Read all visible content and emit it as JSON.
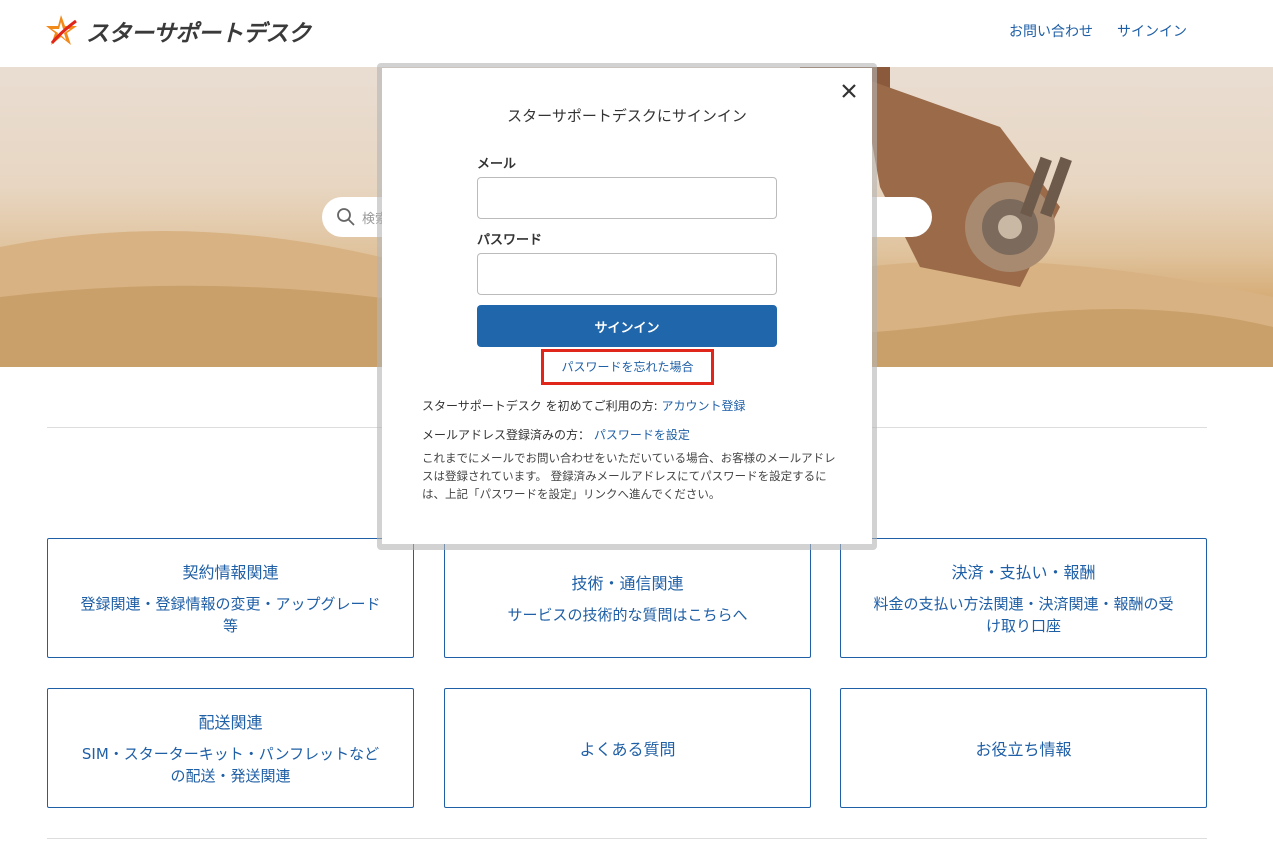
{
  "header": {
    "brand": "スターサポートデスク",
    "nav": {
      "contact": "お問い合わせ",
      "signin": "サインイン"
    }
  },
  "hero": {
    "search_placeholder": "検索"
  },
  "categories": [
    {
      "title": "契約情報関連",
      "desc": "登録関連・登録情報の変更・アップグレード等"
    },
    {
      "title": "技術・通信関連",
      "desc": "サービスの技術的な質問はこちらへ"
    },
    {
      "title": "決済・支払い・報酬",
      "desc": "料金の支払い方法関連・決済関連・報酬の受け取り口座"
    },
    {
      "title": "配送関連",
      "desc": "SIM・スターターキット・パンフレットなどの配送・発送関連"
    },
    {
      "title": "よくある質問",
      "desc": ""
    },
    {
      "title": "お役立ち情報",
      "desc": ""
    }
  ],
  "modal": {
    "title": "スターサポートデスクにサインイン",
    "email_label": "メール",
    "email_value": "",
    "password_label": "パスワード",
    "password_value": "",
    "signin_button": "サインイン",
    "forgot_link": "パスワードを忘れた場合",
    "first_time_text": "スターサポートデスク を初めてご利用の方: ",
    "register_link": "アカウント登録",
    "registered_text": "メールアドレス登録済みの方： ",
    "set_password_link": "パスワードを設定",
    "note": "これまでにメールでお問い合わせをいただいている場合、お客様のメールアドレスは登録されています。 登録済みメールアドレスにてパスワードを設定するには、上記「パスワードを設定」リンクへ進んでください。"
  },
  "colors": {
    "link": "#1f5fa6",
    "button": "#1f66ab",
    "highlight": "#e0261b"
  }
}
